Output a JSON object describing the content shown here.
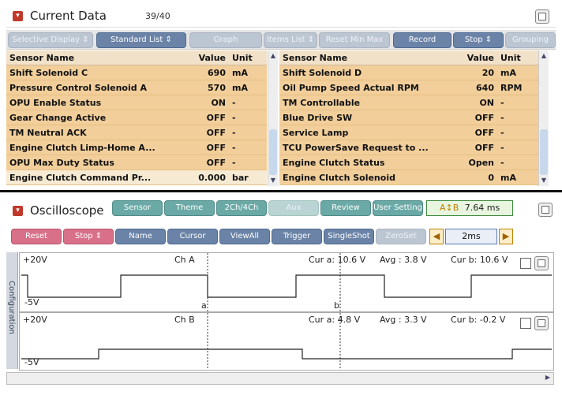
{
  "current_data": {
    "title": "Current Data",
    "count": "39/40",
    "toolbar": {
      "selective_display": "Selective Display ⇕",
      "standard_list": "Standard List ⇕",
      "graph": "Graph",
      "items_list": "Items List ⇕",
      "reset_min_max": "Reset Min Max",
      "record": "Record",
      "stop": "Stop ⇕",
      "grouping": "Grouping"
    },
    "headers": {
      "sensor": "Sensor Name",
      "value": "Value",
      "unit": "Unit"
    },
    "left_rows": [
      {
        "name": "Shift Solenoid C",
        "value": "690",
        "unit": "mA"
      },
      {
        "name": "Pressure Control Solenoid A",
        "value": "570",
        "unit": "mA"
      },
      {
        "name": "OPU Enable Status",
        "value": "ON",
        "unit": "-"
      },
      {
        "name": "Gear Change Active",
        "value": "OFF",
        "unit": "-"
      },
      {
        "name": "TM Neutral ACK",
        "value": "OFF",
        "unit": "-"
      },
      {
        "name": "Engine Clutch Limp-Home A...",
        "value": "OFF",
        "unit": "-"
      },
      {
        "name": "OPU Max Duty Status",
        "value": "OFF",
        "unit": "-"
      },
      {
        "name": "Engine Clutch Command Pr...",
        "value": "0.000",
        "unit": "bar"
      }
    ],
    "right_rows": [
      {
        "name": "Shift Solenoid D",
        "value": "20",
        "unit": "mA"
      },
      {
        "name": "Oil Pump Speed Actual RPM",
        "value": "640",
        "unit": "RPM"
      },
      {
        "name": "TM Controllable",
        "value": "ON",
        "unit": "-"
      },
      {
        "name": "Blue Drive SW",
        "value": "OFF",
        "unit": "-"
      },
      {
        "name": "Service Lamp",
        "value": "OFF",
        "unit": "-"
      },
      {
        "name": "TCU PowerSave Request to ...",
        "value": "OFF",
        "unit": "-"
      },
      {
        "name": "Engine Clutch Status",
        "value": "Open",
        "unit": "-"
      },
      {
        "name": "Engine Clutch Solenoid",
        "value": "0",
        "unit": "mA"
      }
    ],
    "colors": {
      "row": "#f2cf9a",
      "header": "#f1e1c8",
      "selected_row": "#f7ead2"
    }
  },
  "oscilloscope": {
    "title": "Oscilloscope",
    "tabs": {
      "sensor": "Sensor",
      "theme": "Theme",
      "ch": "2Ch/4Ch",
      "aux": "Aux",
      "review": "Review",
      "user_setting": "User Setting"
    },
    "time_readout": "7.64 ms",
    "controls": {
      "reset": "Reset",
      "stop": "Stop ⇕",
      "name": "Name",
      "cursor": "Cursor",
      "view_all": "ViewAll",
      "trigger": "Trigger",
      "single_shot": "SingleShot",
      "zero_set": "ZeroSet",
      "timebase": "2ms"
    },
    "side_tab": "Configuration",
    "channels": [
      {
        "name": "Ch A",
        "top_label": "+20V",
        "bottom_label": "-5V",
        "cur_a": "Cur a: 10.6 V",
        "avg": "Avg : 3.8 V",
        "cur_b": "Cur b: 10.6 V",
        "cursor_a_label": "a",
        "cursor_b_label": "b"
      },
      {
        "name": "Ch B",
        "top_label": "+20V",
        "bottom_label": "-5V",
        "cur_a": "Cur a: 4.8 V",
        "avg": "Avg : 3.3 V",
        "cur_b": "Cur b: -0.2 V"
      }
    ]
  }
}
